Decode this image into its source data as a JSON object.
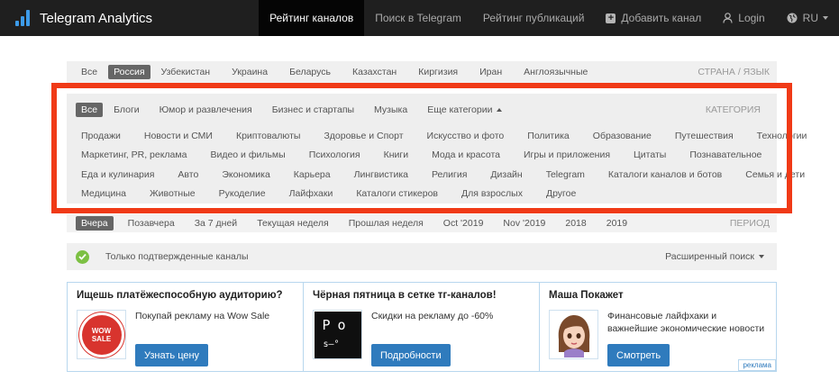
{
  "navbar": {
    "brand": "Telegram Analytics",
    "items": [
      {
        "label": "Рейтинг каналов",
        "active": true
      },
      {
        "label": "Поиск в Telegram",
        "active": false
      },
      {
        "label": "Рейтинг публикаций",
        "active": false
      },
      {
        "label": "Добавить канал",
        "icon": "plus-square-icon"
      },
      {
        "label": "Login",
        "icon": "user-icon"
      },
      {
        "label": "RU",
        "icon": "globe-icon"
      }
    ]
  },
  "country": {
    "items": [
      "Все",
      "Россия",
      "Узбекистан",
      "Украина",
      "Беларусь",
      "Казахстан",
      "Киргизия",
      "Иран",
      "Англоязычные"
    ],
    "active_index": 1,
    "label": "СТРАНА / ЯЗЫК"
  },
  "category": {
    "main": [
      "Все",
      "Блоги",
      "Юмор и развлечения",
      "Бизнес и стартапы",
      "Музыка"
    ],
    "more_label": "Еще категории",
    "label": "КАТЕГОРИЯ",
    "rows": [
      [
        "Продажи",
        "Новости и СМИ",
        "Криптовалюты",
        "Здоровье и Спорт",
        "Искусство и фото",
        "Политика",
        "Образование",
        "Путешествия",
        "Технологии"
      ],
      [
        "Маркетинг, PR, реклама",
        "Видео и фильмы",
        "Психология",
        "Книги",
        "Мода и красота",
        "Игры и приложения",
        "Цитаты",
        "Познавательное"
      ],
      [
        "Еда и кулинария",
        "Авто",
        "Экономика",
        "Карьера",
        "Лингвистика",
        "Религия",
        "Дизайн",
        "Telegram",
        "Каталоги каналов и ботов",
        "Семья и дети"
      ],
      [
        "Медицина",
        "Животные",
        "Рукоделие",
        "Лайфхаки",
        "Каталоги стикеров",
        "Для взрослых",
        "Другое"
      ]
    ]
  },
  "period": {
    "items": [
      "Вчера",
      "Позавчера",
      "За 7 дней",
      "Текущая неделя",
      "Прошлая неделя",
      "Oct '2019",
      "Nov '2019",
      "2018",
      "2019"
    ],
    "active_index": 0,
    "label": "ПЕРИОД"
  },
  "verified": {
    "text": "Только подтвержденные каналы",
    "advanced_search": "Расширенный поиск"
  },
  "promo": {
    "cards": [
      {
        "title": "Ищешь платёжеспособную аудиторию?",
        "text": "Покупай рекламу на Wow Sale",
        "button": "Узнать цену",
        "logo_text": [
          "WOW",
          "SALE"
        ]
      },
      {
        "title": "Чёрная пятница в сетке тг-каналов!",
        "text": "Скидки на рекламу до -60%",
        "button": "Подробности",
        "logo_text": [
          "Po",
          "s"
        ]
      },
      {
        "title": "Маша Покажет",
        "text": "Финансовые лайфхаки и важнейшие экономические новости",
        "button": "Смотреть"
      }
    ],
    "ad_tag": "реклама"
  },
  "colors": {
    "navbar_bg": "#1f1f1f",
    "accent_blue": "#2f7bbd",
    "highlight_frame": "#f03a17",
    "verified_green": "#7cc043",
    "chip_active": "#666666"
  }
}
